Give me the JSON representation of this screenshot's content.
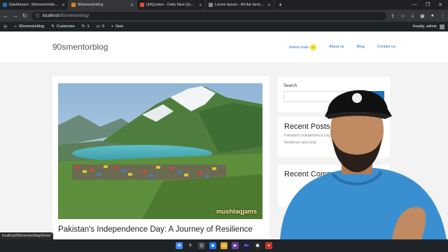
{
  "browser": {
    "tabs": [
      {
        "title": "Dashboard ‹ 90smentorblog — W",
        "color": "#2271b1"
      },
      {
        "title": "90smentorblog",
        "color": "#e67e22"
      },
      {
        "title": "Q4Quotes - Daily New Quotes",
        "color": "#e74c3c"
      },
      {
        "title": "Lorem Ipsum - All the facts - Lips",
        "color": "#888888"
      }
    ],
    "new_tab": "+",
    "url_host": "localhost",
    "url_path": "/90smentorblog/"
  },
  "wp_admin_bar": {
    "site_name": "90smentorblog",
    "customize": "Customize",
    "updates": "1",
    "comments": "0",
    "new": "New",
    "howdy": "Howdy, admin"
  },
  "site": {
    "brand": "90smentorblog",
    "nav": [
      "Home main",
      "About us",
      "Blog",
      "Contact us"
    ],
    "post_title": "Pakistan's Independence Day: A Journey of Resilience",
    "photo_watermark": "mushtaqjams"
  },
  "sidebar": {
    "search_label": "Search",
    "search_button": "Search",
    "recent_posts_heading": "Recent Posts",
    "recent_post_1": "Pakistan's Independence Day: A Journey of",
    "recent_post_2": "Resilience and Unity",
    "recent_comments_heading": "Recent Comments"
  },
  "status_url": "localhost/90smentorblog/home/",
  "colors": {
    "link": "#1e73be",
    "admin_bar": "#1d2327",
    "shirt": "#3a8fd0"
  }
}
